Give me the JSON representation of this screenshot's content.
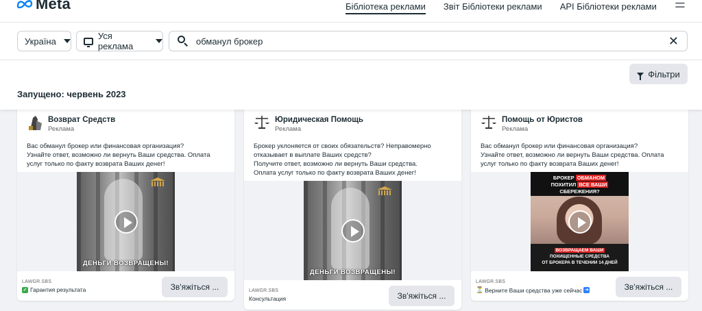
{
  "header": {
    "brand": "Meta",
    "nav": [
      {
        "label": "Бібліотека реклами",
        "active": true
      },
      {
        "label": "Звіт Бібліотеки реклами",
        "active": false
      },
      {
        "label": "API Бібліотеки реклами",
        "active": false
      }
    ],
    "menu_icon": "hamburger-icon"
  },
  "search": {
    "country": "Україна",
    "ad_type": "Уся реклама",
    "query": "обманул брокер"
  },
  "toolbar": {
    "filters_label": "Фільтри",
    "launched_label": "Запущено: червень 2023"
  },
  "cards": [
    {
      "page_name": "Возврат Средств",
      "sponsored": "Реклама",
      "body": [
        "Вас обманул брокер или финансовая организация?",
        "Узнайте ответ, возможно ли вернуть Ваши средства. Оплата",
        "услуг только по факту возврата Ваших денег!"
      ],
      "video_caption": "ДЕНЬГИ ВОЗВРАЩЕНЫ!",
      "domain": "LAWGR.SBS",
      "cta_text": "Гарантия результата",
      "button": "Зв'яжіться ..."
    },
    {
      "page_name": "Юридическая Помощь",
      "sponsored": "Реклама",
      "body": [
        "Брокер уклоняется от своих обязательств? Неправомерно",
        "отказывает в выплате Ваших средств?",
        "Получите ответ, возможно ли вернуть Ваши средства.",
        "Оплата услуг только по факту возврата Ваших денег!"
      ],
      "video_caption": "ДЕНЬГИ ВОЗВРАЩЕНЫ!",
      "domain": "LAWGR.SBS",
      "cta_text": "Консультация",
      "button": "Зв'яжіться ..."
    },
    {
      "page_name": "Помощь от Юристов",
      "sponsored": "Реклама",
      "body": [
        "Вас обманул брокер или финансовая организация?",
        "Узнайте ответ, возможно ли вернуть Ваши средства. Оплата",
        "услуг только по факту возврата Ваших денег!"
      ],
      "promo_top": {
        "l1a": "БРОКЕР ",
        "l1b": "ОБМАНОМ",
        "l2a": "ПОХИТИЛ ",
        "l2b": "ВСЕ ВАШИ",
        "l3": "СБЕРЕЖЕНИЯ?"
      },
      "promo_bottom": {
        "l1": "ВОЗВРАЩАЕМ ВАШИ",
        "l2": "ПОХИЩЕННЫЕ СРЕДСТВА",
        "l3": "ОТ БРОКЕРА В ТЕЧЕНИИ 14 ДНЕЙ"
      },
      "domain": "LAWGR.SBS",
      "cta_text": "Верните Ваши средства уже сейчас",
      "button": "Зв'яжіться ..."
    }
  ],
  "colors": {
    "brand_blue": "#0082fb",
    "text": "#1c2b33",
    "muted": "#65676b",
    "button_bg": "#e4e6eb",
    "page_bg": "#f0f2f5"
  }
}
